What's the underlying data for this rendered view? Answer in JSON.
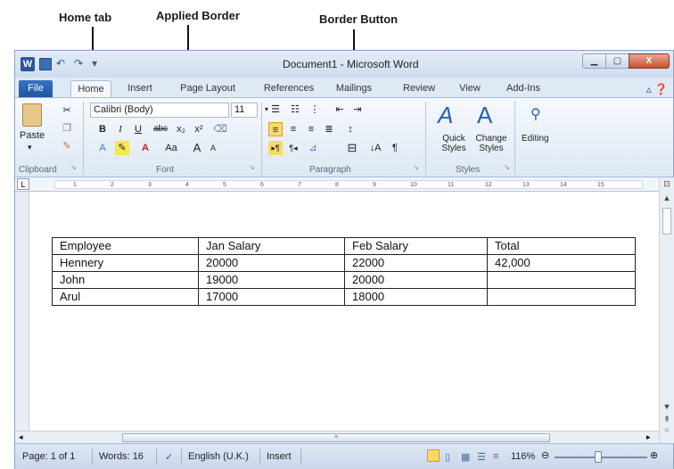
{
  "annotations": {
    "home_tab": "Home tab",
    "applied_border": "Applied Border",
    "border_button": "Border Button"
  },
  "window": {
    "title": "Document1 - Microsoft Word",
    "app_icon": "W",
    "close_glyph": "X"
  },
  "tabs": {
    "file": "File",
    "home": "Home",
    "insert": "Insert",
    "page_layout": "Page Layout",
    "references": "References",
    "mailings": "Mailings",
    "review": "Review",
    "view": "View",
    "addins": "Add-Ins"
  },
  "ribbon": {
    "clipboard": {
      "paste_label": "Paste",
      "group_label": "Clipboard"
    },
    "font": {
      "font_name": "Calibri (Body)",
      "font_size": "11",
      "group_label": "Font",
      "bold": "B",
      "italic": "I",
      "underline": "U",
      "strike": "abc",
      "subscript": "x₂",
      "superscript": "x²",
      "grow": "A",
      "shrink": "A",
      "case": "Aa"
    },
    "paragraph": {
      "group_label": "Paragraph",
      "pilcrow": "¶",
      "sort": "↓A"
    },
    "styles": {
      "quick_styles": "Quick Styles",
      "change_styles": "Change Styles",
      "group_label": "Styles"
    },
    "editing": {
      "label": "Editing"
    }
  },
  "ruler": {
    "ticks": [
      "1",
      "2",
      "3",
      "4",
      "5",
      "6",
      "7",
      "8",
      "9",
      "10",
      "11",
      "12",
      "13",
      "14",
      "15"
    ]
  },
  "table": {
    "rows": [
      [
        "Employee",
        "Jan Salary",
        "Feb Salary",
        "Total"
      ],
      [
        "Hennery",
        "20000",
        "22000",
        "42,000"
      ],
      [
        "John",
        "19000",
        "20000",
        ""
      ],
      [
        "Arul",
        "17000",
        "18000",
        ""
      ]
    ]
  },
  "status": {
    "page": "Page: 1 of 1",
    "words": "Words: 16",
    "language": "English (U.K.)",
    "mode": "Insert",
    "zoom": "116%",
    "zoom_level_pct": 116
  },
  "colors": {
    "file_tab": "#2b65b5",
    "ribbon_bg": "#dfe9f5",
    "close_button": "#c5502f"
  }
}
